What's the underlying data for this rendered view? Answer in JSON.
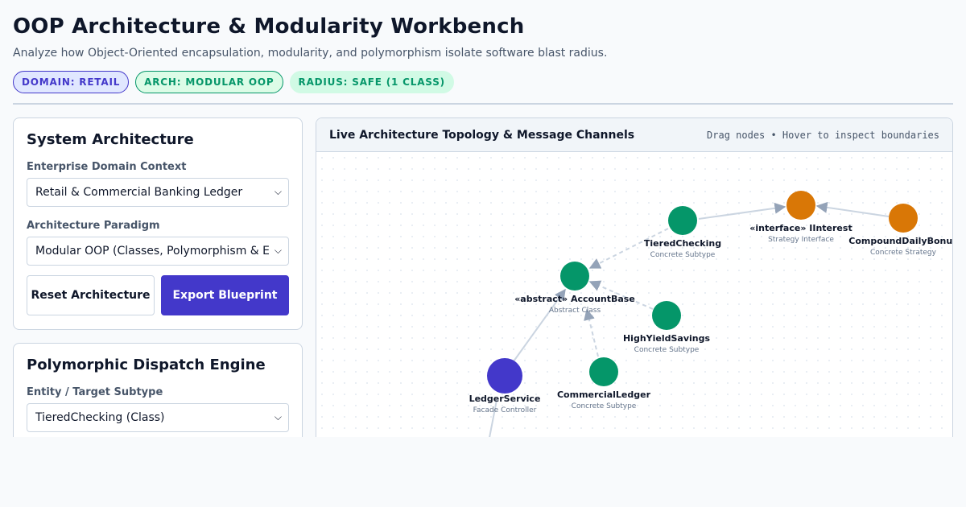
{
  "header": {
    "title": "OOP Architecture & Modularity Workbench",
    "subtitle": "Analyze how Object-Oriented encapsulation, modularity, and polymorphism isolate software blast radius."
  },
  "badges": {
    "domain": "DOMAIN: RETAIL",
    "arch": "ARCH: MODULAR OOP",
    "radius": "RADIUS: SAFE (1 CLASS)"
  },
  "system_architecture": {
    "title": "System Architecture",
    "domain_label": "Enterprise Domain Context",
    "domain_value": "Retail & Commercial Banking Ledger",
    "paradigm_label": "Architecture Paradigm",
    "paradigm_value": "Modular OOP (Classes, Polymorphism & Encapsulation)",
    "reset_label": "Reset Architecture",
    "export_label": "Export Blueprint"
  },
  "dispatch_engine": {
    "title": "Polymorphic Dispatch Engine",
    "target_label": "Entity / Target Subtype",
    "target_value": "TieredChecking (Class)"
  },
  "topology": {
    "title": "Live Architecture Topology & Message Channels",
    "hint": "Drag nodes • Hover to inspect boundaries",
    "nodes": [
      {
        "id": "tiered",
        "name": "TieredChecking",
        "role": "Concrete Subtype",
        "color": "#059669"
      },
      {
        "id": "iinterest",
        "name": "«interface» IInterest",
        "role": "Strategy Interface",
        "color": "#d97706"
      },
      {
        "id": "compound",
        "name": "CompoundDailyBonus",
        "role": "Concrete Strategy",
        "color": "#d97706"
      },
      {
        "id": "accountbase",
        "name": "«abstract» AccountBase",
        "role": "Abstract Class",
        "color": "#059669"
      },
      {
        "id": "highyield",
        "name": "HighYieldSavings",
        "role": "Concrete Subtype",
        "color": "#059669"
      },
      {
        "id": "ledgerservice",
        "name": "LedgerService",
        "role": "Facade Controller",
        "color": "#4338ca"
      },
      {
        "id": "commercial",
        "name": "CommercialLedger",
        "role": "Concrete Subtype",
        "color": "#059669"
      }
    ]
  },
  "colors": {
    "accent": "#4338ca",
    "success": "#059669",
    "strategy": "#d97706",
    "edge": "#cbd5e1",
    "arrow": "#94a3b8"
  }
}
